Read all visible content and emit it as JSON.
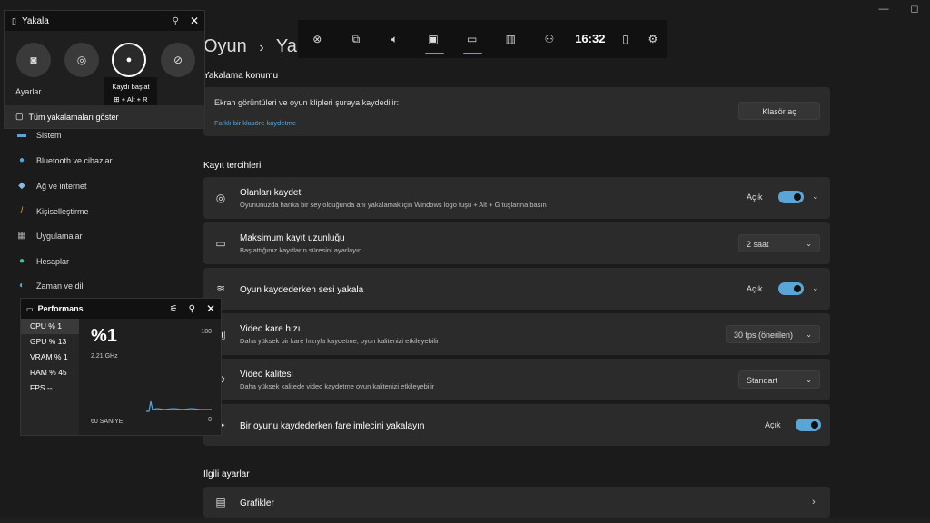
{
  "window_controls": {
    "minimize": "—",
    "restore": "◻"
  },
  "breadcrumb": {
    "part1": "Oyun",
    "separator": "›",
    "part2": "Yakalamalar"
  },
  "capture_location": {
    "section": "Yakalama konumu",
    "title": "Ekran görüntüleri ve oyun klipleri şuraya kaydedilir:",
    "link": "Farklı bir klasöre kaydetme",
    "button": "Klasör aç"
  },
  "recording_prefs": {
    "section": "Kayıt tercihleri",
    "items": [
      {
        "title": "Olanları kaydet",
        "subtitle": "Oyununuzda harika bir şey olduğunda anı yakalamak için Windows logo tuşu + Alt + G tuşlarına basın",
        "state": "Açık"
      },
      {
        "title": "Maksimum kayıt uzunluğu",
        "subtitle": "Başlattığınız kayıtların süresini ayarlayın",
        "value": "2 saat"
      },
      {
        "title": "Oyun kaydederken sesi yakala",
        "state": "Açık"
      },
      {
        "title": "Video kare hızı",
        "subtitle": "Daha yüksek bir kare hızıyla kaydetme, oyun kalitenizi etkileyebilir",
        "value": "30 fps (önerilen)"
      },
      {
        "title": "Video kalitesi",
        "subtitle": "Daha yüksek kalitede video kaydetme oyun kalitenizi etkileyebilir",
        "value": "Standart"
      },
      {
        "title": "Bir oyunu kaydederken fare imlecini yakalayın",
        "state": "Açık"
      }
    ]
  },
  "related": {
    "section": "İlgili ayarlar",
    "item": "Grafikler"
  },
  "nav": [
    "Sistem",
    "Bluetooth ve cihazlar",
    "Ağ ve internet",
    "Kişiselleştirme",
    "Uygulamalar",
    "Hesaplar",
    "Zaman ve dil"
  ],
  "capture_widget": {
    "title": "Yakala",
    "settings_label": "Ayarlar",
    "tooltip_title": "Kaydı başlat",
    "tooltip_shortcut": "+ Alt + R",
    "show_all": "Tüm yakalamaları göster"
  },
  "gamebar": {
    "time": "16:32"
  },
  "performance": {
    "title": "Performans",
    "metrics": [
      {
        "label": "CPU %",
        "value": "1"
      },
      {
        "label": "GPU %",
        "value": "13"
      },
      {
        "label": "VRAM %",
        "value": "1"
      },
      {
        "label": "RAM %",
        "value": "45"
      },
      {
        "label": "FPS",
        "value": "--"
      }
    ],
    "big_value": "%1",
    "frequency": "2.21 GHz",
    "max": "100",
    "min": "0",
    "duration": "60 SANİYE"
  },
  "colors": {
    "accent": "#5aa4d6",
    "card": "#2b2b2b",
    "background": "#1b1b1b"
  }
}
